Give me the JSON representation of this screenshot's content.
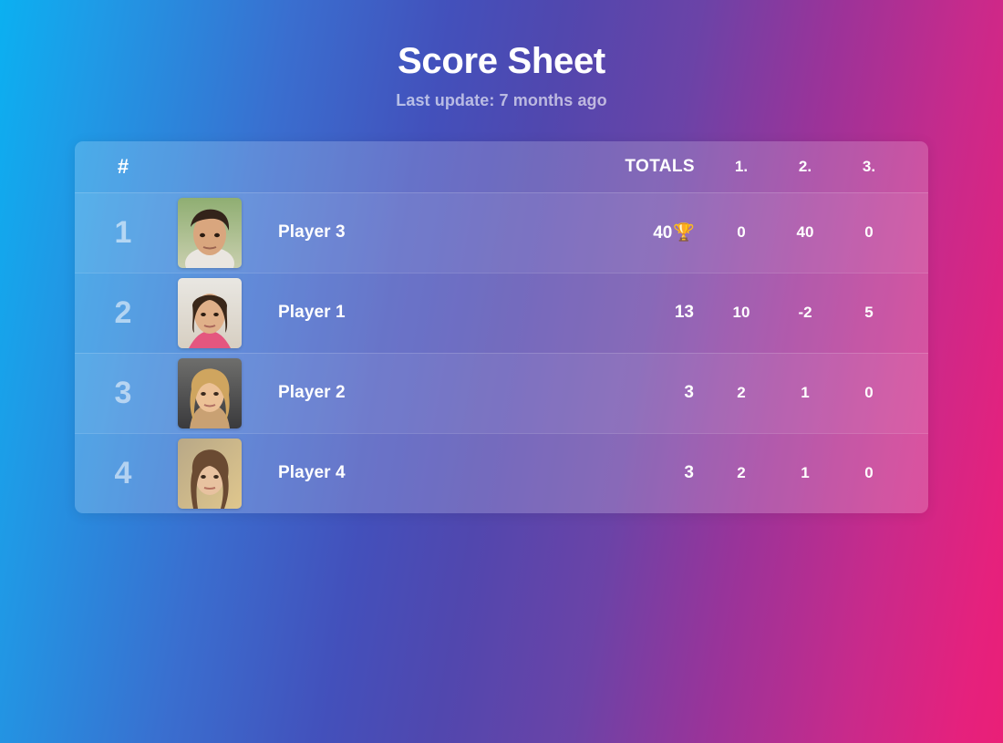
{
  "header": {
    "title": "Score Sheet",
    "subtitle": "Last update: 7 months ago"
  },
  "table": {
    "columns": {
      "rank": "#",
      "avatar": "",
      "name": "",
      "totals": "TOTALS",
      "rounds": [
        "1.",
        "2.",
        "3."
      ]
    },
    "rows": [
      {
        "rank": "1",
        "name": "Player 3",
        "total": "40",
        "trophy": "🏆",
        "rounds": [
          "0",
          "40",
          "0"
        ],
        "avatar_name": "avatar-player-3"
      },
      {
        "rank": "2",
        "name": "Player 1",
        "total": "13",
        "trophy": "",
        "rounds": [
          "10",
          "-2",
          "5"
        ],
        "avatar_name": "avatar-player-1"
      },
      {
        "rank": "3",
        "name": "Player 2",
        "total": "3",
        "trophy": "",
        "rounds": [
          "2",
          "1",
          "0"
        ],
        "avatar_name": "avatar-player-2"
      },
      {
        "rank": "4",
        "name": "Player 4",
        "total": "3",
        "trophy": "",
        "rounds": [
          "2",
          "1",
          "0"
        ],
        "avatar_name": "avatar-player-4"
      }
    ]
  },
  "colors": {
    "background_start": "#0bb0f1",
    "background_mid": "#5147ae",
    "background_end": "#ea1f77",
    "text": "#ffffff",
    "subtitle": "rgba(255,255,255,0.62)",
    "rank": "rgba(255,255,255,0.55)",
    "trophy_gold": "#e8a92a"
  }
}
